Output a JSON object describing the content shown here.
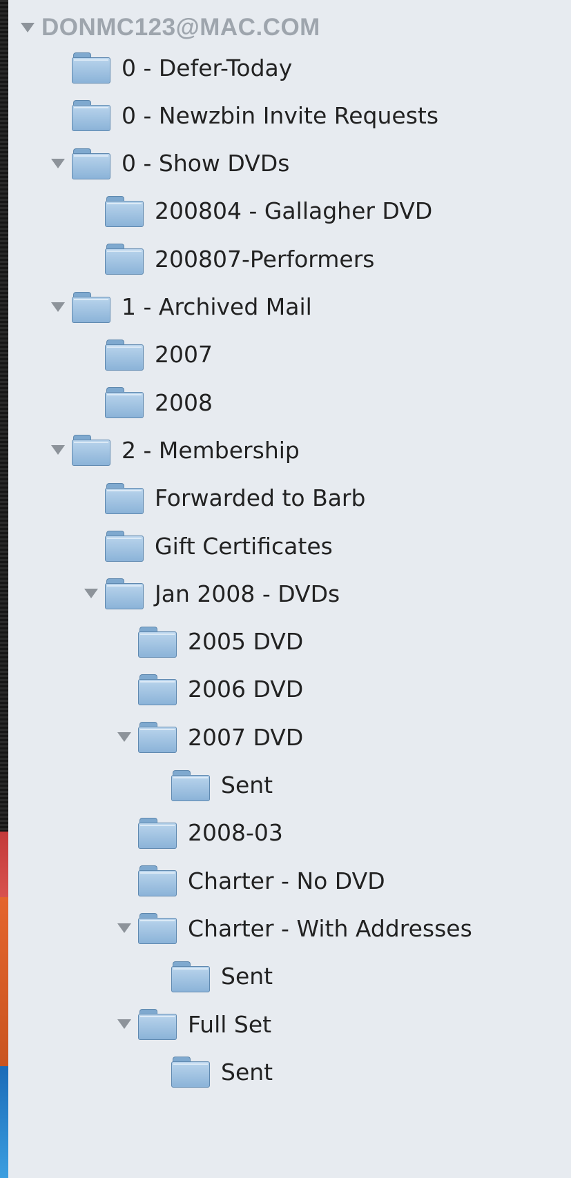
{
  "account": {
    "label": "DONMC123@MAC.COM"
  },
  "folders": [
    {
      "label": "0 - Defer-Today",
      "level": 1,
      "expanded": false
    },
    {
      "label": "0 - Newzbin Invite Requests",
      "level": 1,
      "expanded": false
    },
    {
      "label": "0 - Show DVDs",
      "level": 1,
      "expanded": true
    },
    {
      "label": "200804 - Gallagher DVD",
      "level": 2,
      "expanded": false
    },
    {
      "label": "200807-Performers",
      "level": 2,
      "expanded": false
    },
    {
      "label": "1 - Archived Mail",
      "level": 1,
      "expanded": true
    },
    {
      "label": "2007",
      "level": 2,
      "expanded": false
    },
    {
      "label": "2008",
      "level": 2,
      "expanded": false
    },
    {
      "label": "2 - Membership",
      "level": 1,
      "expanded": true
    },
    {
      "label": "Forwarded to Barb",
      "level": 2,
      "expanded": false
    },
    {
      "label": "Gift Certificates",
      "level": 2,
      "expanded": false
    },
    {
      "label": "Jan 2008 - DVDs",
      "level": 2,
      "expanded": true
    },
    {
      "label": "2005 DVD",
      "level": 3,
      "expanded": false
    },
    {
      "label": "2006 DVD",
      "level": 3,
      "expanded": false
    },
    {
      "label": "2007 DVD",
      "level": 3,
      "expanded": true
    },
    {
      "label": "Sent",
      "level": 4,
      "expanded": false
    },
    {
      "label": "2008-03",
      "level": 3,
      "expanded": false
    },
    {
      "label": "Charter - No DVD",
      "level": 3,
      "expanded": false
    },
    {
      "label": "Charter - With Addresses",
      "level": 3,
      "expanded": true
    },
    {
      "label": "Sent",
      "level": 4,
      "expanded": false
    },
    {
      "label": "Full Set",
      "level": 3,
      "expanded": true
    },
    {
      "label": "Sent",
      "level": 4,
      "expanded": false
    }
  ],
  "icons": {
    "folder": "folder-icon",
    "disclosure": "disclosure-triangle-icon"
  },
  "colors": {
    "sidebar_bg": "#e7ebf0",
    "account_text": "#9ea5ad",
    "item_text": "#222222",
    "folder_fill": "#a7c7e6",
    "triangle": "#8d939a"
  }
}
